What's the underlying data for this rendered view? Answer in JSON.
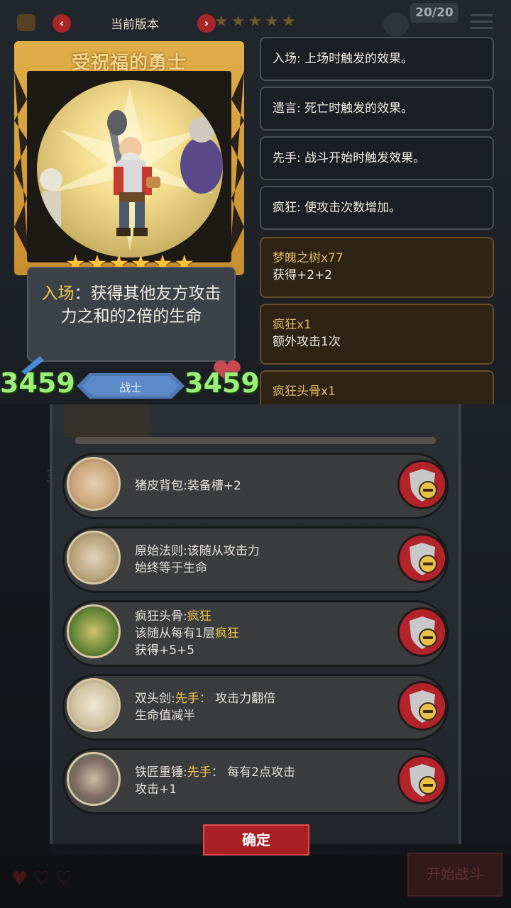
{
  "header": {
    "title": "当前版本",
    "prev_arrow": "‹",
    "next_arrow": "›",
    "stars": "★★★★★",
    "counter": "20/20"
  },
  "card": {
    "name": "受祝福的勇士",
    "stars": "★★★★★★",
    "description_keyword": "入场",
    "description_rest": "：获得其他友方攻击力之和的2倍的生命",
    "attack": "3459",
    "health": "3459",
    "type": "战士"
  },
  "keywords": [
    {
      "text": "入场: 上场时触发的效果。"
    },
    {
      "text": "遗言: 死亡时触发的效果。"
    },
    {
      "text": "先手: 战斗开始时触发效果。"
    },
    {
      "text": "疯狂: 使攻击次数增加。"
    }
  ],
  "item_keywords": [
    {
      "title": "梦魄之树x77",
      "desc": "获得+2+2"
    },
    {
      "title": "疯狂x1",
      "desc": "额外攻击1次"
    },
    {
      "title": "疯狂头骨x1",
      "desc": ""
    }
  ],
  "equipment": [
    {
      "line1_a": "猪皮背包:装备槽+2",
      "line1_kw": "",
      "line1_b": "",
      "line2_a": "",
      "line2_kw": "",
      "line2_b": "",
      "line3": ""
    },
    {
      "line1_a": "原始法则:该随从攻击力",
      "line1_kw": "",
      "line1_b": "",
      "line2_a": "始终等于生命",
      "line2_kw": "",
      "line2_b": "",
      "line3": ""
    },
    {
      "line1_a": "疯狂头骨:",
      "line1_kw": "疯狂",
      "line1_b": "",
      "line2_a": "该随从每有1层",
      "line2_kw": "疯狂",
      "line2_b": "",
      "line3": "获得+5+5"
    },
    {
      "line1_a": "双头剑:",
      "line1_kw": "先手",
      "line1_b": "： 攻击力翻倍",
      "line2_a": "生命值减半",
      "line2_kw": "",
      "line2_b": "",
      "line3": ""
    },
    {
      "line1_a": "铁匠重锤:",
      "line1_kw": "先手",
      "line1_b": "： 每有2点攻击",
      "line2_a": "攻击+1",
      "line2_kw": "",
      "line2_b": "",
      "line3": ""
    }
  ],
  "confirm_label": "确定",
  "start_battle_label": "开始战斗",
  "side_number": "3",
  "colors": {
    "accent_gold": "#f0c34c",
    "stat_green": "#9cf07a",
    "button_red": "#b3232a"
  }
}
